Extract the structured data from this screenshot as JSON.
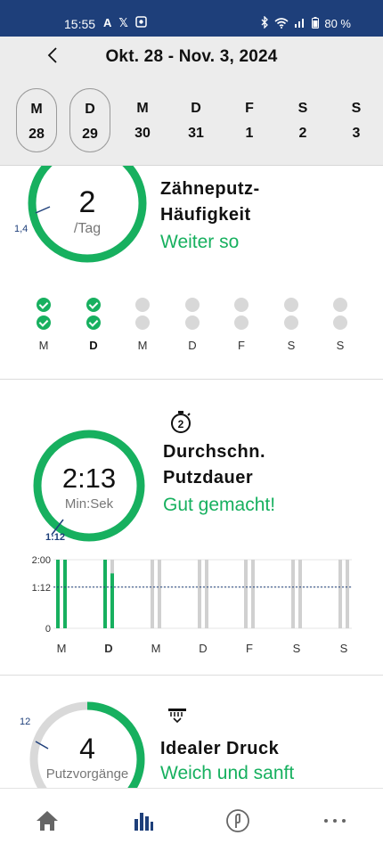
{
  "status_bar": {
    "time": "15:55",
    "left_icons": [
      "font-icon",
      "x-icon",
      "gallery-icon"
    ],
    "right_icons": [
      "bluetooth-icon",
      "wifi-icon",
      "signal-icon",
      "battery-icon"
    ],
    "battery": "80 %"
  },
  "header": {
    "range": "Okt. 28 - Nov. 3, 2024",
    "days": [
      {
        "letter": "M",
        "num": "28",
        "selected": true
      },
      {
        "letter": "D",
        "num": "29",
        "selected": true
      },
      {
        "letter": "M",
        "num": "30",
        "selected": false
      },
      {
        "letter": "D",
        "num": "31",
        "selected": false
      },
      {
        "letter": "F",
        "num": "1",
        "selected": false
      },
      {
        "letter": "S",
        "num": "2",
        "selected": false
      },
      {
        "letter": "S",
        "num": "3",
        "selected": false
      }
    ]
  },
  "frequency": {
    "value": "2",
    "unit": "/Tag",
    "target": "1,4",
    "title_line1": "Zähneputz-",
    "title_line2": "Häufigkeit",
    "status": "Weiter so",
    "day_labels": [
      "M",
      "D",
      "M",
      "D",
      "F",
      "S",
      "S"
    ],
    "current_day_index": 1,
    "sessions": [
      [
        true,
        true
      ],
      [
        true,
        true
      ],
      [
        false,
        false
      ],
      [
        false,
        false
      ],
      [
        false,
        false
      ],
      [
        false,
        false
      ],
      [
        false,
        false
      ]
    ]
  },
  "duration": {
    "icon": "stopwatch-2-icon",
    "value": "2:13",
    "unit": "Min:Sek",
    "target": "1:12",
    "title_line1": "Durchschn.",
    "title_line2": "Putzdauer",
    "status": "Gut gemacht!",
    "progress": 1.0,
    "y_axis_labels": [
      "2:00",
      "1:12",
      "0"
    ],
    "day_labels": [
      "M",
      "D",
      "M",
      "D",
      "F",
      "S",
      "S"
    ],
    "current_day_index": 1,
    "bar_fractions": [
      [
        1.0,
        1.0
      ],
      [
        1.0,
        0.8
      ],
      [
        0,
        0
      ],
      [
        0,
        0
      ],
      [
        0,
        0
      ],
      [
        0,
        0
      ],
      [
        0,
        0
      ]
    ],
    "colors": {
      "done": "#17b05f",
      "empty": "#d0d0d0",
      "target_line": "#1e3f7a"
    }
  },
  "pressure": {
    "icon": "brush-pressure-icon",
    "value": "4",
    "unit": "Putzvorgänge",
    "target": "12",
    "title": "Idealer Druck",
    "status": "Weich und sanft",
    "progress": 0.45
  },
  "nav": {
    "items": [
      "home-icon",
      "stats-icon",
      "brush-head-icon",
      "more-icon"
    ],
    "active_index": 1,
    "colors": {
      "active": "#1e3f7a",
      "inactive": "#666666"
    }
  },
  "colors": {
    "accent": "#17b05f",
    "brand": "#1e3f7a",
    "ring_bg": "#d9d9d9"
  }
}
